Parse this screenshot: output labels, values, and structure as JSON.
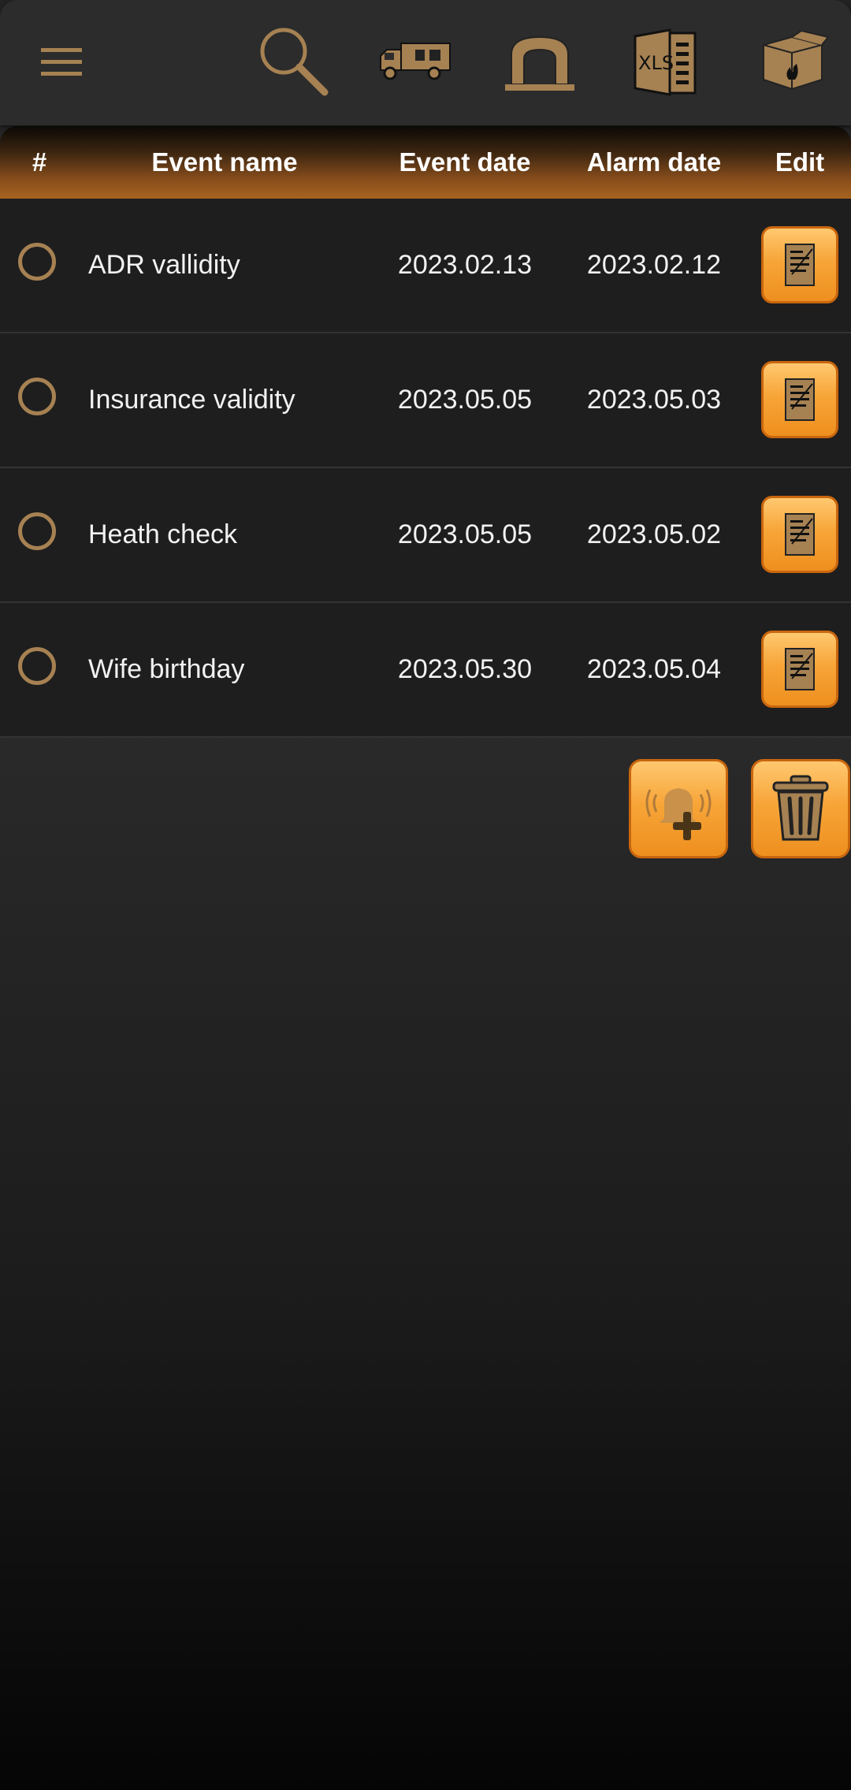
{
  "toolbar": {
    "icons": [
      "menu-icon",
      "search-icon",
      "truck-icon",
      "archway-icon",
      "xls-icon",
      "box-fire-icon"
    ]
  },
  "table": {
    "headers": {
      "number": "#",
      "event_name": "Event name",
      "event_date": "Event date",
      "alarm_date": "Alarm date",
      "edit": "Edit"
    },
    "rows": [
      {
        "name": "ADR vallidity",
        "event_date": "2023.02.13",
        "alarm_date": "2023.02.12",
        "selected": false
      },
      {
        "name": "Insurance validity",
        "event_date": "2023.05.05",
        "alarm_date": "2023.05.03",
        "selected": false
      },
      {
        "name": "Heath check",
        "event_date": "2023.05.05",
        "alarm_date": "2023.05.02",
        "selected": false
      },
      {
        "name": "Wife birthday",
        "event_date": "2023.05.30",
        "alarm_date": "2023.05.04",
        "selected": false
      }
    ]
  },
  "actions": {
    "icons": [
      "add-alarm-icon",
      "trash-icon"
    ]
  },
  "colors": {
    "accent": "#f7a538",
    "icon_tan": "#a68152",
    "background": "#232323"
  }
}
